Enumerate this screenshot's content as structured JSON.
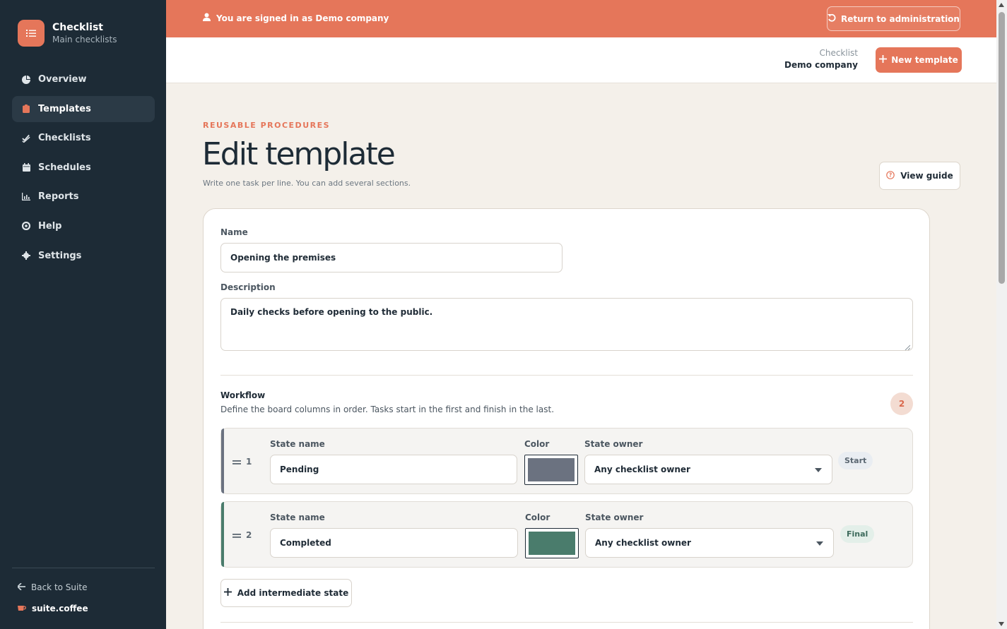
{
  "sidebar": {
    "brand_title": "Checklist",
    "brand_subtitle": "Main checklists",
    "items": [
      {
        "label": "Overview",
        "icon": "pie-chart-icon"
      },
      {
        "label": "Templates",
        "icon": "clipboard-icon",
        "active": true
      },
      {
        "label": "Checklists",
        "icon": "double-check-icon"
      },
      {
        "label": "Schedules",
        "icon": "calendar-icon"
      },
      {
        "label": "Reports",
        "icon": "bar-chart-icon"
      },
      {
        "label": "Help",
        "icon": "life-ring-icon"
      },
      {
        "label": "Settings",
        "icon": "gear-icon"
      }
    ],
    "back_label": "Back to Suite",
    "suite_label": "suite.coffee"
  },
  "banner": {
    "text": "You are signed in as Demo company",
    "return_label": "Return to administration"
  },
  "header": {
    "context_app": "Checklist",
    "context_company": "Demo company",
    "new_template_label": "New template"
  },
  "page": {
    "eyebrow": "REUSABLE PROCEDURES",
    "title": "Edit template",
    "subtitle": "Write one task per line. You can add several sections.",
    "guide_label": "View guide"
  },
  "form": {
    "name_label": "Name",
    "name_value": "Opening the premises",
    "description_label": "Description",
    "description_value": "Daily checks before opening to the public.",
    "workflow_title": "Workflow",
    "workflow_subtitle": "Define the board columns in order. Tasks start in the first and finish in the last.",
    "workflow_count": "2",
    "states": [
      {
        "index": "1",
        "name_label": "State name",
        "name": "Pending",
        "color_label": "Color",
        "color": "#6b7280",
        "owner_label": "State owner",
        "owner": "Any checklist owner",
        "badge": "Start"
      },
      {
        "index": "2",
        "name_label": "State name",
        "name": "Completed",
        "color_label": "Color",
        "color": "#4a7c6c",
        "owner_label": "State owner",
        "owner": "Any checklist owner",
        "badge": "Final"
      }
    ],
    "add_state_label": "Add intermediate state"
  },
  "colors": {
    "accent": "#e5765a",
    "sidebar_bg": "#1d2b36",
    "page_bg": "#f4f0ea"
  }
}
